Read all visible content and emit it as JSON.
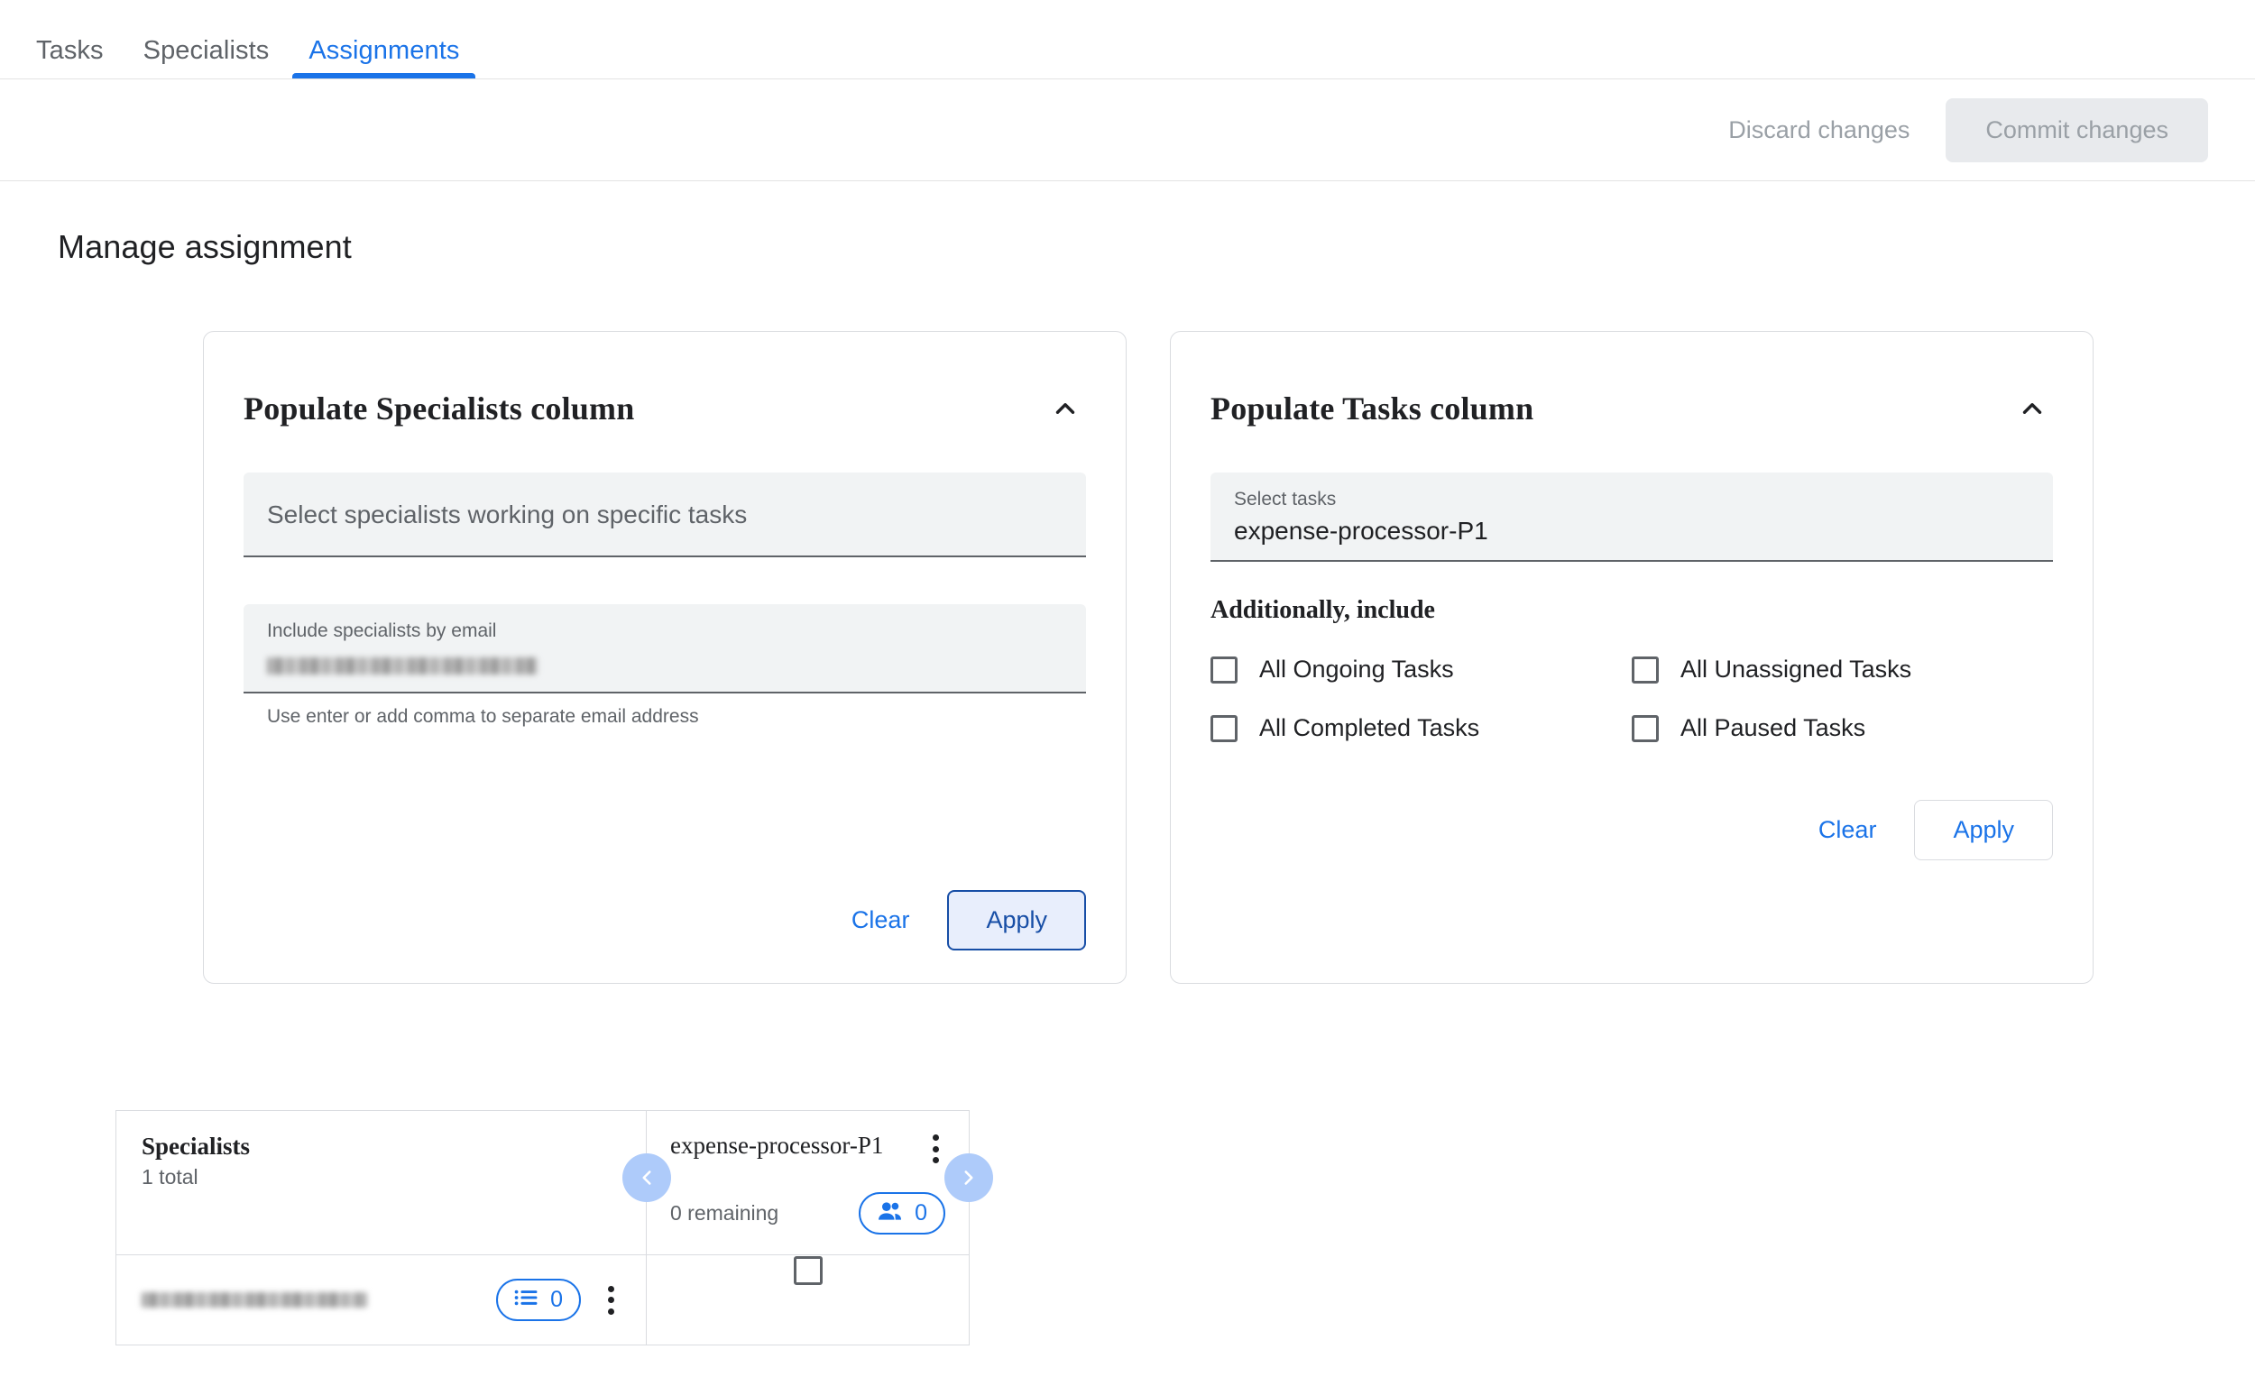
{
  "tabs": [
    {
      "label": "Tasks",
      "active": false
    },
    {
      "label": "Specialists",
      "active": false
    },
    {
      "label": "Assignments",
      "active": true
    }
  ],
  "actionbar": {
    "discard_label": "Discard changes",
    "commit_label": "Commit changes"
  },
  "page": {
    "title": "Manage assignment"
  },
  "specialists_card": {
    "title": "Populate Specialists column",
    "collapse_icon": "chevron-up-icon",
    "select_field": {
      "placeholder": "Select specialists working on specific tasks"
    },
    "email_field": {
      "label": "Include specialists by email",
      "value": "",
      "hint": "Use enter or add comma to separate email address"
    },
    "clear_label": "Clear",
    "apply_label": "Apply"
  },
  "tasks_card": {
    "title": "Populate Tasks column",
    "collapse_icon": "chevron-up-icon",
    "select_field": {
      "label": "Select tasks",
      "value": "expense-processor-P1"
    },
    "additionally_label": "Additionally, include",
    "checkboxes": [
      {
        "label": "All Ongoing Tasks",
        "checked": false
      },
      {
        "label": "All Unassigned Tasks",
        "checked": false
      },
      {
        "label": "All Completed Tasks",
        "checked": false
      },
      {
        "label": "All Paused Tasks",
        "checked": false
      }
    ],
    "clear_label": "Clear",
    "apply_label": "Apply"
  },
  "matrix": {
    "specialists_header": {
      "title": "Specialists",
      "subtitle": "1 total"
    },
    "task_column": {
      "name": "expense-processor-P1",
      "remaining": "0 remaining",
      "people_count": "0",
      "people_icon": "people-icon",
      "menu_icon": "kebab-menu-icon",
      "prev_icon": "chevron-left-icon",
      "next_icon": "chevron-right-icon"
    },
    "rows": [
      {
        "email": "",
        "list_count": "0",
        "list_icon": "list-icon",
        "menu_icon": "kebab-menu-icon",
        "assigned": false
      }
    ]
  },
  "colors": {
    "accent": "#1a73e8",
    "accent_dark": "#174ea6",
    "accent_light": "#aecbfa",
    "muted": "#5f6368",
    "disabled": "#9aa0a6",
    "border": "#dadce0",
    "field_bg": "#f1f3f4"
  }
}
